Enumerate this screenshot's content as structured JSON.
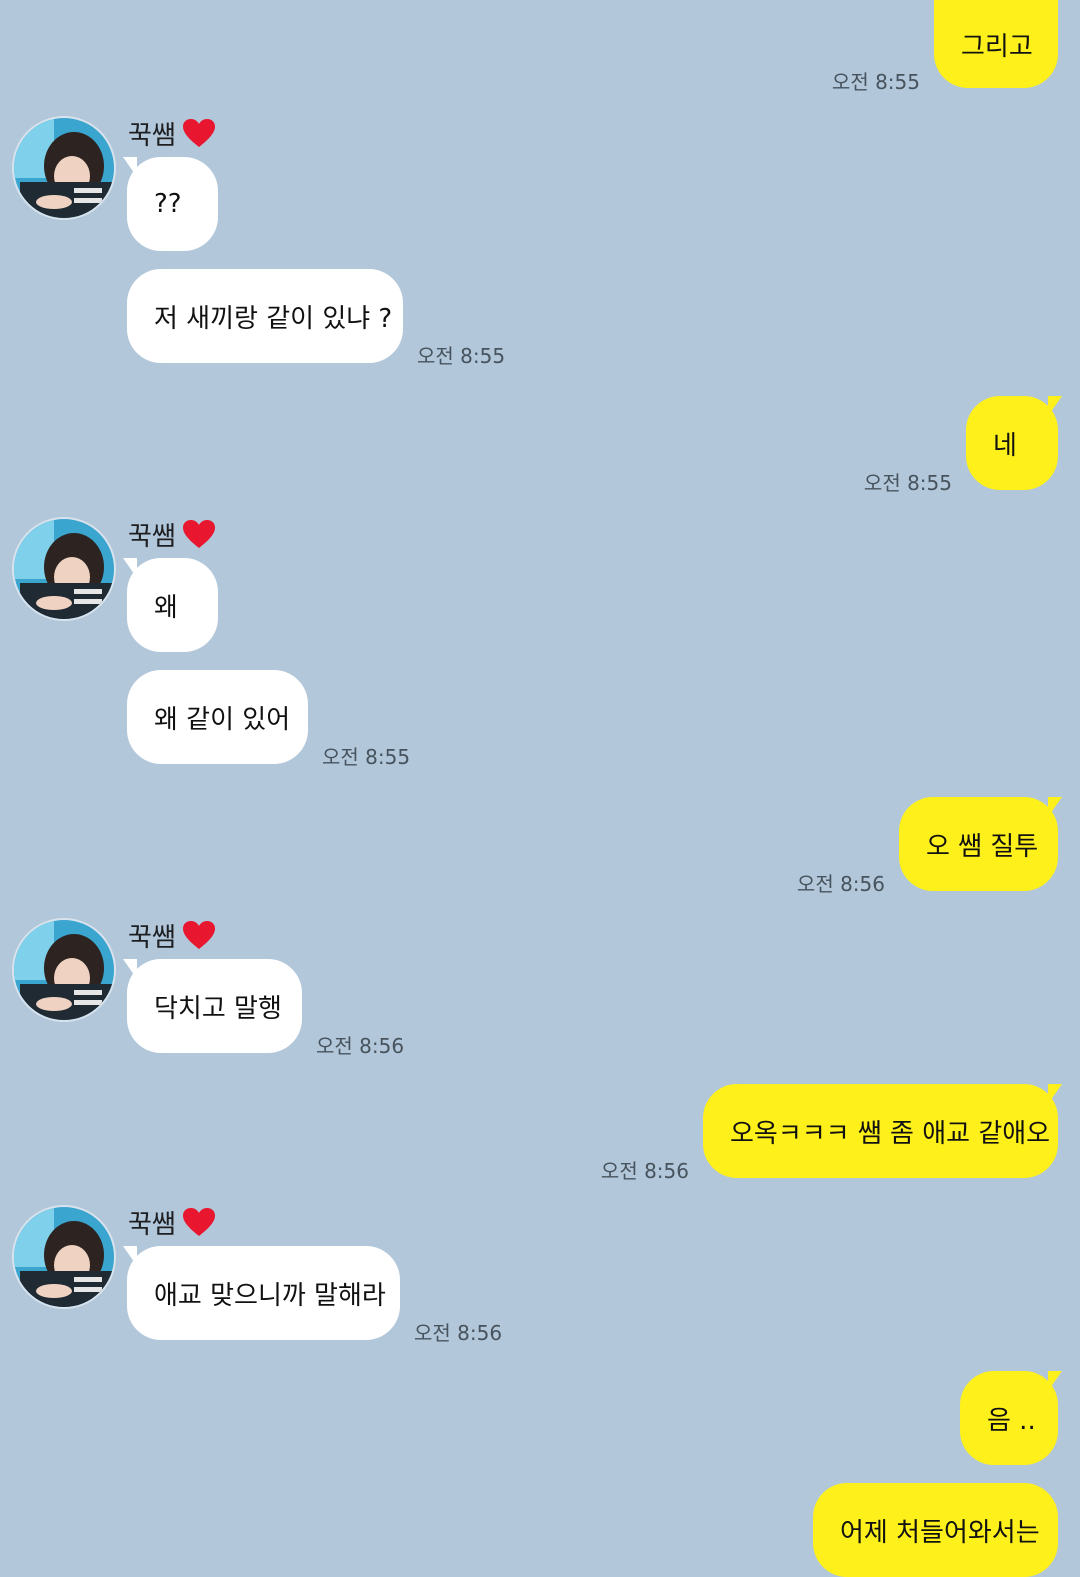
{
  "sender_name": "꾹쌤",
  "heart_icon": "heart-icon",
  "colors": {
    "background": "#b2c7da",
    "my_bubble": "#fef01b",
    "their_bubble": "#ffffff",
    "heart": "#e8162f"
  },
  "messages": [
    {
      "from": "me",
      "text": "그리고",
      "time": "오전 8:55"
    },
    {
      "from": "them",
      "text": "??"
    },
    {
      "from": "them",
      "text": "저 새끼랑 같이 있냐 ?",
      "time": "오전 8:55"
    },
    {
      "from": "me",
      "text": "네",
      "time": "오전 8:55"
    },
    {
      "from": "them",
      "text": "왜"
    },
    {
      "from": "them",
      "text": "왜 같이 있어",
      "time": "오전 8:55"
    },
    {
      "from": "me",
      "text": "오 쌤 질투",
      "time": "오전 8:56"
    },
    {
      "from": "them",
      "text": "닥치고 말행",
      "time": "오전 8:56"
    },
    {
      "from": "me",
      "text": "오옥ㅋㅋㅋ 쌤 좀 애교 같애오",
      "time": "오전 8:56"
    },
    {
      "from": "them",
      "text": "애교 맞으니까 말해라",
      "time": "오전 8:56"
    },
    {
      "from": "me",
      "text": "음 .."
    },
    {
      "from": "me",
      "text": "어제 처들어와서는"
    }
  ]
}
